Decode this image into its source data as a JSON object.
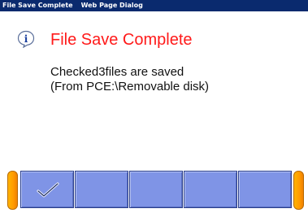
{
  "window": {
    "title": "File Save Complete",
    "subtitle": "Web Page Dialog"
  },
  "dialog": {
    "icon": "info-icon",
    "headline": "File Save Complete",
    "message_line1": "Checked3files are saved",
    "message_line2": "(From PCE:\\Removable disk)"
  },
  "toolbar": {
    "buttons": [
      {
        "icon": "checkmark-icon"
      },
      {
        "icon": ""
      },
      {
        "icon": ""
      },
      {
        "icon": ""
      },
      {
        "icon": ""
      }
    ],
    "accent_color": "#ff9a00",
    "button_color": "#7f94e6"
  },
  "colors": {
    "titlebar": "#0a2a6e",
    "headline": "#ff1a1a"
  }
}
